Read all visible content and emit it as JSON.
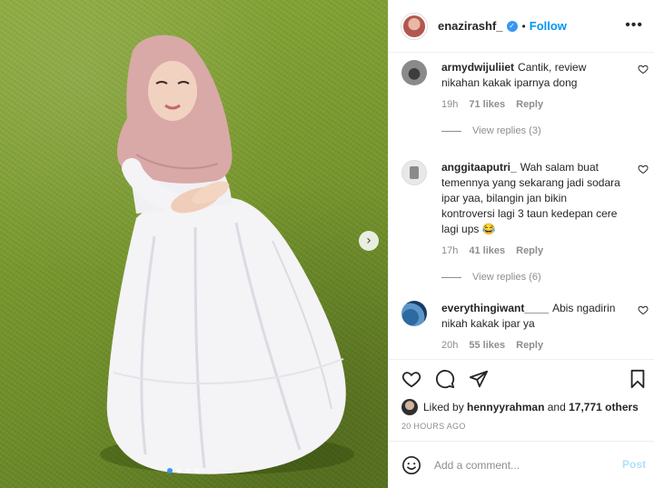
{
  "post": {
    "owner": {
      "username": "enazirashf_",
      "verified": true,
      "follow_label": "Follow",
      "separator": "•"
    },
    "more_icon": "more-horizontal-icon",
    "carousel_next_icon": "chevron-right-icon",
    "carousel": {
      "total": 4,
      "active_index": 0
    }
  },
  "comments": [
    {
      "username": "armydwijuliiet",
      "text": "Cantik, review nikahan kakak iparnya dong",
      "time": "19h",
      "likes": "71 likes",
      "reply_label": "Reply",
      "view_replies": "View replies (3)"
    },
    {
      "username": "anggitaaputri_",
      "text": "Wah salam buat temennya yang sekarang jadi sodara ipar yaa, bilangin jan bikin kontroversi lagi 3 taun kedepan cere lagi ups 😂",
      "time": "17h",
      "likes": "41 likes",
      "reply_label": "Reply",
      "view_replies": "View replies (6)"
    },
    {
      "username": "everythingiwant____",
      "text": "Abis ngadirin nikah kakak ipar ya",
      "time": "20h",
      "likes": "55 likes",
      "reply_label": "Reply"
    }
  ],
  "actions": {
    "icons": [
      "heart-icon",
      "comment-icon",
      "share-icon",
      "bookmark-icon"
    ],
    "liked_by_prefix": "Liked by",
    "liked_by_user": "hennyyrahman",
    "liked_by_and": "and",
    "liked_by_count": "17,771 others",
    "timestamp": "20 HOURS AGO"
  },
  "add_comment": {
    "placeholder": "Add a comment...",
    "post_label": "Post",
    "emoji_icon": "emoji-icon"
  },
  "colors": {
    "accent": "#0095f6",
    "verified": "#3897f0",
    "muted": "#8e8e8e",
    "post_disabled": "#b2dffc"
  }
}
